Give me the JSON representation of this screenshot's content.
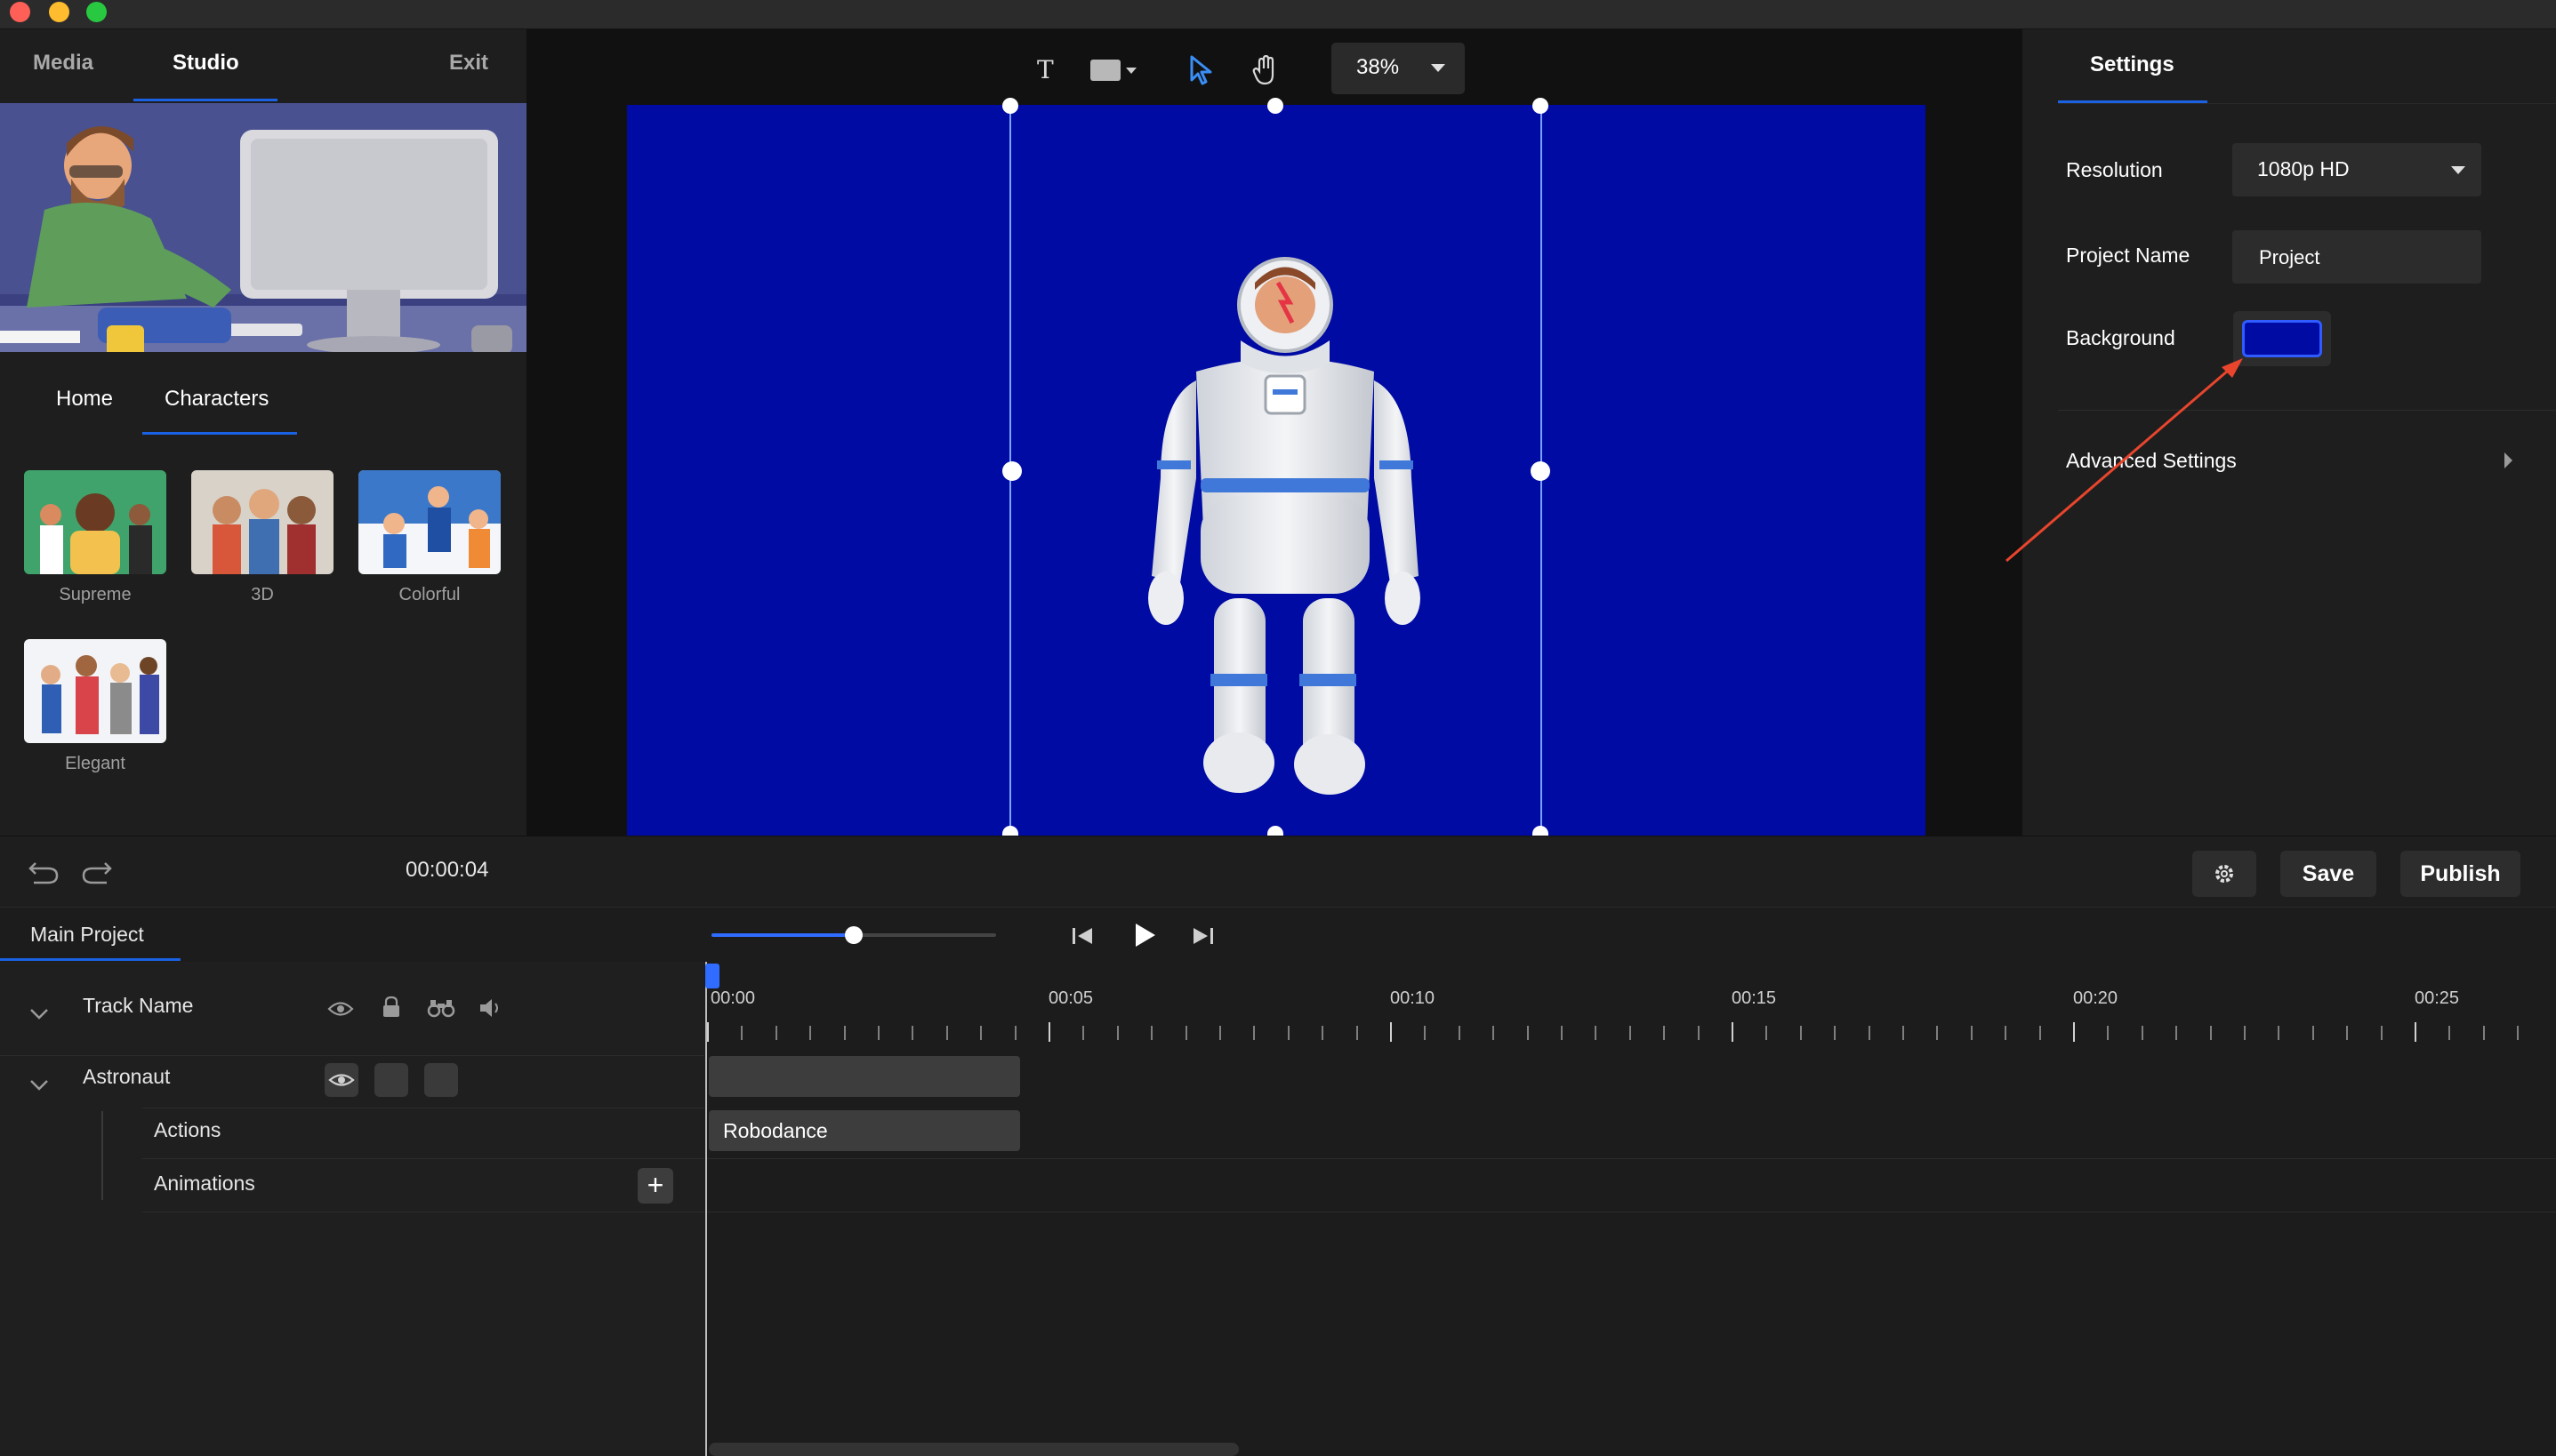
{
  "window": {
    "traffic_lights": [
      "#fe5f57",
      "#febc2e",
      "#28c840"
    ]
  },
  "left_panel": {
    "tabs": [
      {
        "label": "Media",
        "active": false
      },
      {
        "label": "Studio",
        "active": true
      }
    ],
    "exit_label": "Exit",
    "subtabs": [
      {
        "label": "Home",
        "active": false
      },
      {
        "label": "Characters",
        "active": true
      }
    ],
    "character_styles": [
      {
        "label": "Supreme"
      },
      {
        "label": "3D"
      },
      {
        "label": "Colorful"
      },
      {
        "label": "Elegant"
      }
    ]
  },
  "toolbar": {
    "text_tool_icon": "T",
    "zoom_value": "38%"
  },
  "settings": {
    "title": "Settings",
    "resolution_label": "Resolution",
    "resolution_value": "1080p HD",
    "project_name_label": "Project Name",
    "project_name_value": "Project",
    "background_label": "Background",
    "background_color": "#000ba3",
    "advanced_label": "Advanced Settings"
  },
  "controls": {
    "timecode": "00:00:04",
    "save_label": "Save",
    "publish_label": "Publish",
    "playback_progress": 0.5
  },
  "timeline": {
    "project_tab": "Main Project",
    "track_header": "Track Name",
    "tracks": [
      {
        "name": "Astronaut",
        "children": [
          "Actions",
          "Animations"
        ]
      }
    ],
    "clip_label": "Robodance",
    "time_labels": [
      "00:00",
      "00:05",
      "00:10",
      "00:15",
      "00:20",
      "00:25"
    ]
  },
  "annotation": {
    "color": "#e8452c"
  }
}
